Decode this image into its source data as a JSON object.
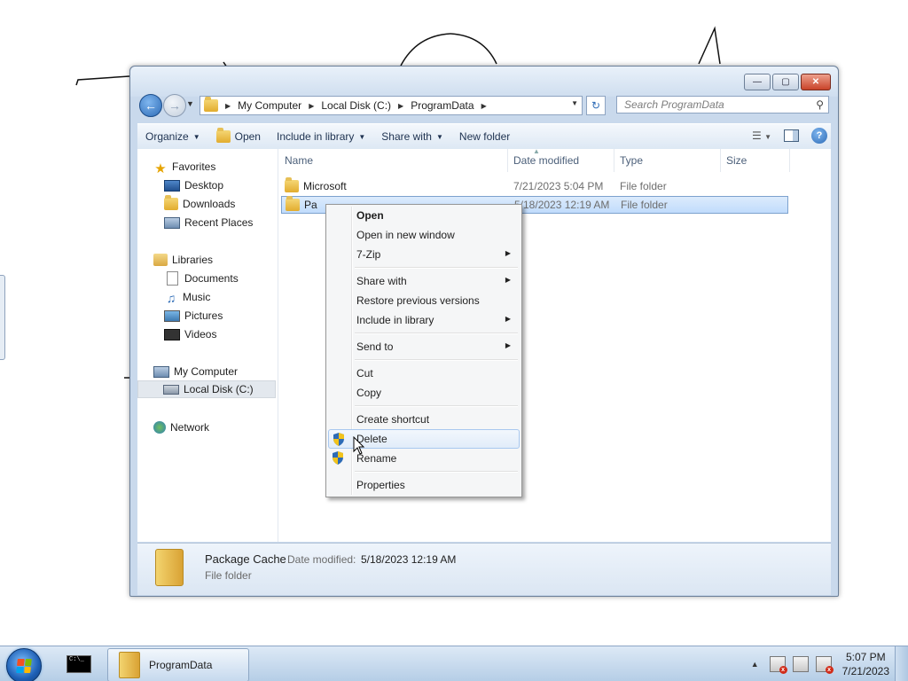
{
  "window": {
    "caption_buttons": {
      "minimize": "—",
      "maximize": "▢",
      "close": "✕"
    }
  },
  "address_bar": {
    "crumbs": [
      "My Computer",
      "Local Disk (C:)",
      "ProgramData"
    ],
    "search_placeholder": "Search ProgramData"
  },
  "command_bar": {
    "organize": "Organize",
    "open": "Open",
    "include_in_library": "Include in library",
    "share_with": "Share with",
    "new_folder": "New folder"
  },
  "nav_pane": {
    "favorites": "Favorites",
    "desktop": "Desktop",
    "downloads": "Downloads",
    "recent_places": "Recent Places",
    "libraries": "Libraries",
    "documents": "Documents",
    "music": "Music",
    "pictures": "Pictures",
    "videos": "Videos",
    "my_computer": "My Computer",
    "local_disk": "Local Disk (C:)",
    "network": "Network"
  },
  "columns": {
    "name": "Name",
    "date_modified": "Date modified",
    "type": "Type",
    "size": "Size"
  },
  "files": [
    {
      "name": "Microsoft",
      "date": "7/21/2023 5:04 PM",
      "type": "File folder"
    },
    {
      "name": "Pa",
      "date": "5/18/2023 12:19 AM",
      "type": "File folder"
    }
  ],
  "details": {
    "name": "Package Cache",
    "modified_label": "Date modified:",
    "modified_value": "5/18/2023 12:19 AM",
    "type": "File folder"
  },
  "context_menu": {
    "open": "Open",
    "open_new_window": "Open in new window",
    "seven_zip": "7-Zip",
    "share_with": "Share with",
    "restore_previous": "Restore previous versions",
    "include_in_library": "Include in library",
    "send_to": "Send to",
    "cut": "Cut",
    "copy": "Copy",
    "create_shortcut": "Create shortcut",
    "delete": "Delete",
    "rename": "Rename",
    "properties": "Properties"
  },
  "taskbar": {
    "folder_button": "ProgramData",
    "cmd_glyph": "C:\\_",
    "time": "5:07 PM",
    "date": "7/21/2023"
  },
  "colors": {
    "selection": "#cce4fc",
    "accent": "#2d6bb6",
    "start_logo": [
      "#f25022",
      "#7fba00",
      "#00a4ef",
      "#ffb900"
    ]
  }
}
